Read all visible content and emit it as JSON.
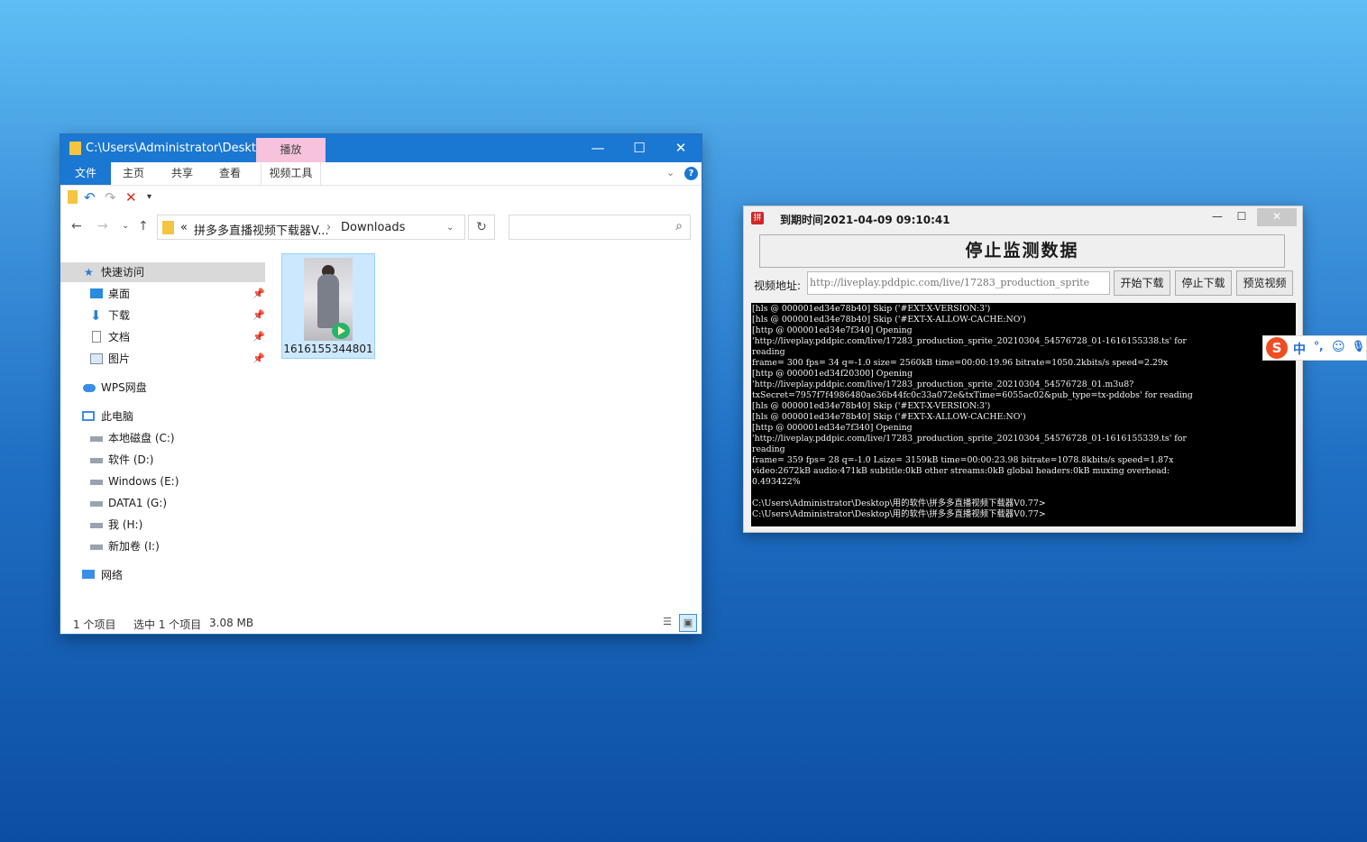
{
  "explorer": {
    "title_path": "C:\\Users\\Administrator\\Deskto...",
    "context_tab": "播放",
    "window_buttons": {
      "minimize": "—",
      "maximize": "☐",
      "close": "✕"
    },
    "ribbon_tabs": [
      "文件",
      "主页",
      "共享",
      "查看",
      "视频工具"
    ],
    "address": {
      "overflow": "«",
      "crumbs": [
        "拼多多直播视频下载器V...",
        "Downloads"
      ],
      "separator": "›"
    },
    "search_placeholder": "",
    "nav": {
      "quick_access": "快速访问",
      "desktop": "桌面",
      "downloads": "下载",
      "documents": "文档",
      "pictures": "图片",
      "wps": "WPS网盘",
      "this_pc": "此电脑",
      "drive_c": "本地磁盘 (C:)",
      "drive_d": "软件 (D:)",
      "drive_e": "Windows (E:)",
      "drive_g": "DATA1 (G:)",
      "drive_h": "我 (H:)",
      "drive_i": "新加卷 (I:)",
      "network": "网络"
    },
    "file": {
      "name": "1616155344801"
    },
    "status": {
      "items": "1 个项目",
      "selected": "选中 1 个项目",
      "size": "3.08 MB"
    }
  },
  "downloader": {
    "title": "到期时间2021-04-09 09:10:41",
    "window_buttons": {
      "minimize": "—",
      "maximize": "☐",
      "close": "✕"
    },
    "stop_monitor_label": "停止监测数据",
    "url_label": "视频地址:",
    "url_value": "http://liveplay.pddpic.com/live/17283_production_sprite",
    "start_download": "开始下载",
    "stop_download": "停止下载",
    "preview_video": "预览视频",
    "console_lines": [
      "[hls @ 000001ed34e78b40] Skip ('#EXT-X-VERSION:3')",
      "[hls @ 000001ed34e78b40] Skip ('#EXT-X-ALLOW-CACHE:NO')",
      "[http @ 000001ed34e7f340] Opening",
      "'http://liveplay.pddpic.com/live/17283_production_sprite_20210304_54576728_01-1616155338.ts' for",
      "reading",
      "frame=  300 fps= 34 q=-1.0 size=    2560kB time=00:00:19.96 bitrate=1050.2kbits/s speed=2.29x",
      "[http @ 000001ed34f20300] Opening",
      "'http://liveplay.pddpic.com/live/17283_production_sprite_20210304_54576728_01.m3u8?",
      "txSecret=7957f7f4986480ae36b44fc0c33a072e&txTime=6055ac02&pub_type=tx-pddobs' for reading",
      "[hls @ 000001ed34e78b40] Skip ('#EXT-X-VERSION:3')",
      "[hls @ 000001ed34e78b40] Skip ('#EXT-X-ALLOW-CACHE:NO')",
      "[http @ 000001ed34e7f340] Opening",
      "'http://liveplay.pddpic.com/live/17283_production_sprite_20210304_54576728_01-1616155339.ts' for",
      "reading",
      "frame=  359 fps= 28 q=-1.0 Lsize=    3159kB time=00:00:23.98 bitrate=1078.8kbits/s speed=1.87x",
      "video:2672kB audio:471kB subtitle:0kB other streams:0kB global headers:0kB muxing overhead:",
      "0.493422%",
      "",
      "C:\\Users\\Administrator\\Desktop\\用的软件\\拼多多直播视频下载器V0.77>",
      "C:\\Users\\Administrator\\Desktop\\用的软件\\拼多多直播视频下载器V0.77>"
    ]
  },
  "ime": {
    "logo": "S",
    "mode": "中",
    "punct": "°,",
    "emoji": "☺",
    "mic": "🎙"
  },
  "colors": {
    "titlebar": "#1a77d2",
    "context_tab": "#f6c2dc",
    "console_bg": "#000000",
    "selection": "#cce8ff"
  }
}
